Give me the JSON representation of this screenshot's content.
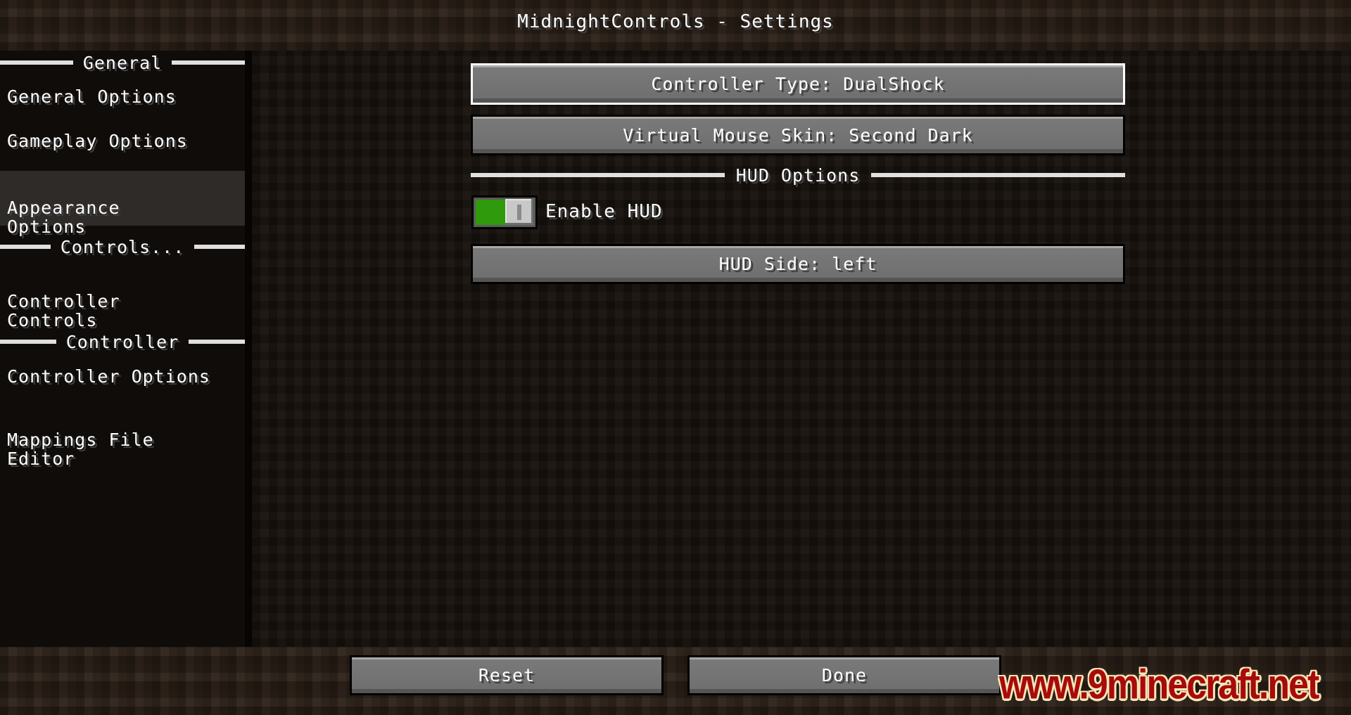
{
  "header": {
    "title": "MidnightControls - Settings"
  },
  "sidebar": {
    "sections": [
      {
        "label": "General",
        "items": [
          {
            "label": "General Options",
            "active": false
          },
          {
            "label": "Gameplay Options",
            "active": false
          },
          {
            "label": "Appearance\nOptions",
            "active": true
          }
        ]
      },
      {
        "label": "Controls...",
        "items": [
          {
            "label": "Controller\nControls",
            "active": false
          }
        ]
      },
      {
        "label": "Controller",
        "items": [
          {
            "label": "Controller Options",
            "active": false
          },
          {
            "label": "Mappings File\nEditor",
            "active": false
          }
        ]
      }
    ]
  },
  "main": {
    "controller_type_button": "Controller Type: DualShock",
    "virtual_mouse_skin_button": "Virtual Mouse Skin: Second Dark",
    "hud_section_label": "HUD Options",
    "enable_hud": {
      "label": "Enable HUD",
      "value": true
    },
    "hud_side_button": "HUD Side: left"
  },
  "footer": {
    "reset_label": "Reset",
    "done_label": "Done"
  },
  "watermark": "www.9minecraft.net",
  "colors": {
    "toggle_on": "#2e9a0c",
    "focus_border": "#ffffff",
    "watermark_red": "#a80b0b"
  }
}
